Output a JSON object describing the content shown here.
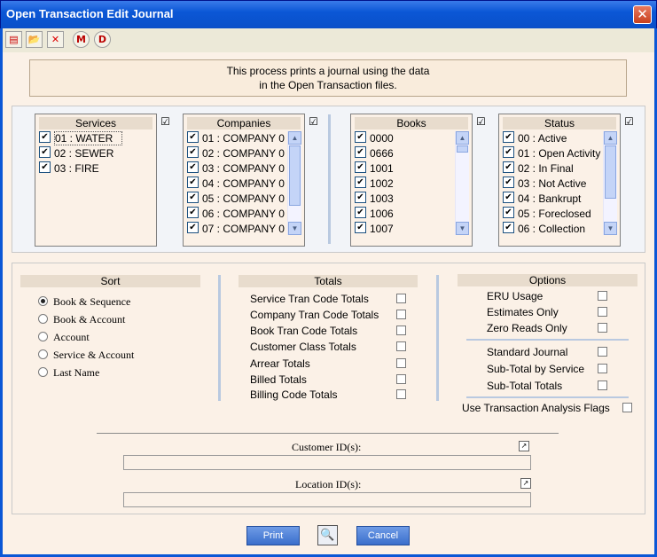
{
  "window": {
    "title": "Open Transaction Edit Journal",
    "close_glyph": "✕"
  },
  "toolbar": [
    {
      "name": "report-icon",
      "glyph": "▤"
    },
    {
      "name": "open-folder-icon",
      "glyph": "📂"
    },
    {
      "name": "delete-icon",
      "glyph": "✕"
    },
    {
      "name": "m-icon",
      "glyph": "M"
    },
    {
      "name": "d-icon",
      "glyph": "D"
    }
  ],
  "banner": {
    "line1": "This process prints a journal using the data",
    "line2": "in the Open Transaction files."
  },
  "lists": {
    "services": {
      "title": "Services",
      "items": [
        {
          "label": "01 : WATER",
          "checked": true
        },
        {
          "label": "02 : SEWER",
          "checked": true
        },
        {
          "label": "03 : FIRE",
          "checked": true
        }
      ]
    },
    "companies": {
      "title": "Companies",
      "items": [
        {
          "label": "01 : COMPANY 0",
          "checked": true
        },
        {
          "label": "02 : COMPANY 0",
          "checked": true
        },
        {
          "label": "03 : COMPANY 0",
          "checked": true
        },
        {
          "label": "04 : COMPANY 0",
          "checked": true
        },
        {
          "label": "05 : COMPANY 0",
          "checked": true
        },
        {
          "label": "06 : COMPANY 0",
          "checked": true
        },
        {
          "label": "07 : COMPANY 0",
          "checked": true
        }
      ]
    },
    "books": {
      "title": "Books",
      "items": [
        {
          "label": "0000",
          "checked": true
        },
        {
          "label": "0666",
          "checked": true
        },
        {
          "label": "1001",
          "checked": true
        },
        {
          "label": "1002",
          "checked": true
        },
        {
          "label": "1003",
          "checked": true
        },
        {
          "label": "1006",
          "checked": true
        },
        {
          "label": "1007",
          "checked": true
        }
      ]
    },
    "status": {
      "title": "Status",
      "items": [
        {
          "label": "00 : Active",
          "checked": true
        },
        {
          "label": "01 : Open Activity",
          "checked": true
        },
        {
          "label": "02 : In Final",
          "checked": true
        },
        {
          "label": "03 : Not Active",
          "checked": true
        },
        {
          "label": "04 : Bankrupt",
          "checked": true
        },
        {
          "label": "05 : Foreclosed",
          "checked": true
        },
        {
          "label": "06 : Collection",
          "checked": true
        }
      ]
    }
  },
  "sort": {
    "title": "Sort",
    "selected_index": 0,
    "options": [
      "Book & Sequence",
      "Book & Account",
      "Account",
      "Service & Account",
      "Last Name"
    ]
  },
  "totals": {
    "title": "Totals",
    "items": [
      "Service Tran Code Totals",
      "Company Tran Code Totals",
      "Book Tran Code Totals",
      "Customer Class Totals",
      "Arrear Totals",
      "Billed Totals",
      "Billing Code Totals"
    ]
  },
  "options": {
    "title": "Options",
    "group1": [
      "ERU Usage",
      "Estimates Only",
      "Zero Reads Only"
    ],
    "group2": [
      "Standard Journal",
      "Sub-Total by Service",
      "Sub-Total Totals"
    ],
    "analysis_flag": "Use Transaction Analysis Flags"
  },
  "filters": {
    "customer_label": "Customer ID(s):",
    "location_label": "Location ID(s):",
    "customer_value": "",
    "location_value": ""
  },
  "buttons": {
    "print": "Print",
    "cancel": "Cancel"
  }
}
